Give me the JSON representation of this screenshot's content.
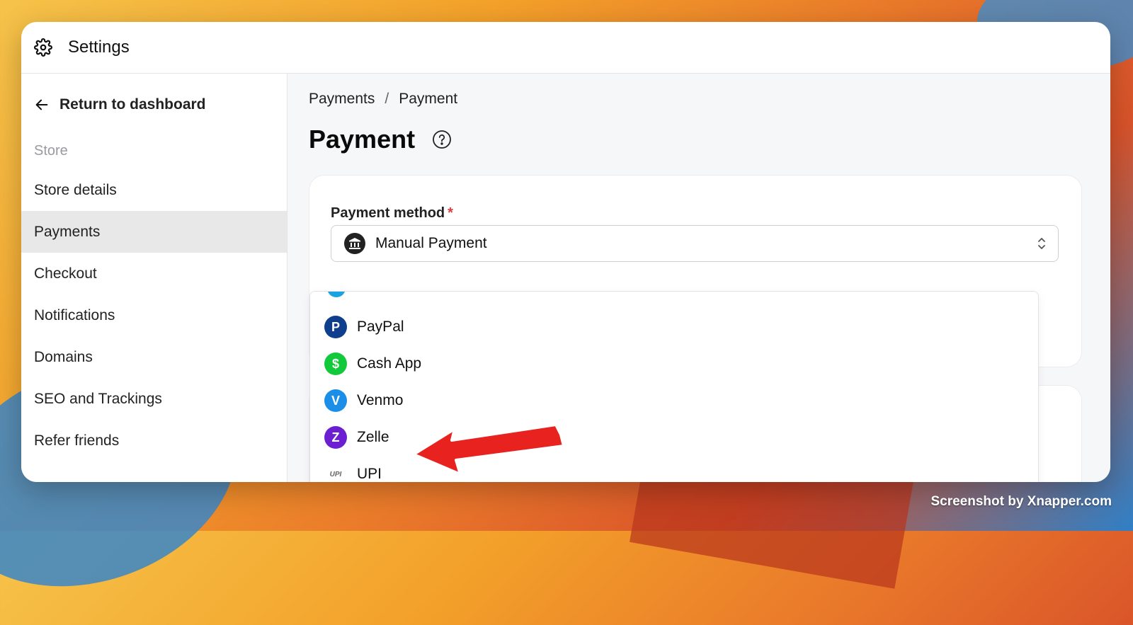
{
  "window": {
    "title": "Settings"
  },
  "sidebar": {
    "return_label": "Return to dashboard",
    "section_label": "Store",
    "items": [
      {
        "label": "Store details"
      },
      {
        "label": "Payments"
      },
      {
        "label": "Checkout"
      },
      {
        "label": "Notifications"
      },
      {
        "label": "Domains"
      },
      {
        "label": "SEO and Trackings"
      },
      {
        "label": "Refer friends"
      }
    ],
    "active": "Payments"
  },
  "main": {
    "breadcrumb": [
      "Payments",
      "Payment"
    ],
    "breadcrumb_sep": "/",
    "title": "Payment",
    "field_label": "Payment method",
    "required_mark": "*",
    "selected_value": "Manual Payment"
  },
  "dropdown": {
    "options": [
      {
        "label": "PayPal",
        "icon": "paypal-icon",
        "color": "#0f3f8c",
        "glyph": "P"
      },
      {
        "label": "Cash App",
        "icon": "cash-app-icon",
        "color": "#11c93a",
        "glyph": "$"
      },
      {
        "label": "Venmo",
        "icon": "venmo-icon",
        "color": "#1b8fe8",
        "glyph": "V"
      },
      {
        "label": "Zelle",
        "icon": "zelle-icon",
        "color": "#6c1fd1",
        "glyph": "Z"
      },
      {
        "label": "UPI",
        "icon": "upi-icon",
        "color": "#ffffff",
        "glyph": "UPI"
      }
    ]
  },
  "watermark": "Screenshot by Xnapper.com"
}
